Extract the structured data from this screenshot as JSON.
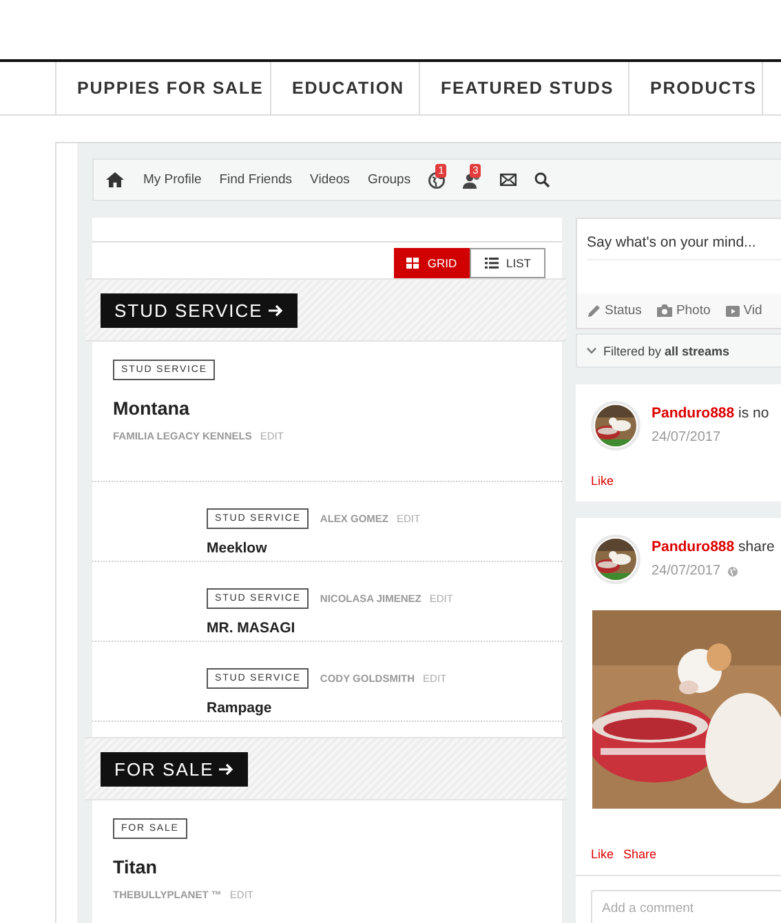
{
  "nav_tabs": [
    "PUPPIES FOR SALE",
    "EDUCATION",
    "FEATURED STUDS",
    "PRODUCTS"
  ],
  "toolbar": {
    "links": [
      "My Profile",
      "Find Friends",
      "Videos",
      "Groups"
    ],
    "notifications": [
      {
        "kind": "globe",
        "badge": "1"
      },
      {
        "kind": "friends",
        "badge": "3"
      }
    ]
  },
  "view_toggle": [
    {
      "label": "GRID",
      "kind": "grid",
      "selected": true
    },
    {
      "label": "LIST",
      "kind": "list",
      "selected": false
    }
  ],
  "sections": [
    {
      "heading": "STUD SERVICE",
      "featured": {
        "tag": "STUD SERVICE",
        "name": "Montana",
        "owner": "FAMILIA LEGACY KENNELS",
        "action": "EDIT"
      },
      "related": [
        {
          "tag": "STUD SERVICE",
          "owner": "ALEX GOMEZ",
          "action": "EDIT",
          "name": "Meeklow"
        },
        {
          "tag": "STUD SERVICE",
          "owner": "NICOLASA JIMENEZ",
          "action": "EDIT",
          "name": "MR. MASAGI"
        },
        {
          "tag": "STUD SERVICE",
          "owner": "CODY GOLDSMITH",
          "action": "EDIT",
          "name": "Rampage"
        }
      ]
    },
    {
      "heading": "FOR SALE",
      "featured": {
        "tag": "FOR SALE",
        "name": "Titan",
        "owner": "THEBULLYPLANET ™",
        "action": "EDIT"
      }
    }
  ],
  "composer": {
    "placeholder": "Say what's on your mind...",
    "actions": [
      {
        "kind": "status",
        "label": "Status"
      },
      {
        "label": "Photo"
      },
      {
        "kind": "video",
        "label": "Vid"
      }
    ]
  },
  "filter": "Filtered by **all streams**",
  "posts": [
    {
      "author": "Panduro888",
      "text": "is no",
      "date": "24/07/2017",
      "public": false,
      "actions": [
        "Like"
      ]
    },
    {
      "author": "Panduro888",
      "text": "share",
      "date": "24/07/2017",
      "public": true,
      "media": {
        "kind": "picture"
      },
      "actions": [
        "Like",
        "Share"
      ]
    }
  ],
  "comment": {
    "placeholder": "Add a comment"
  }
}
